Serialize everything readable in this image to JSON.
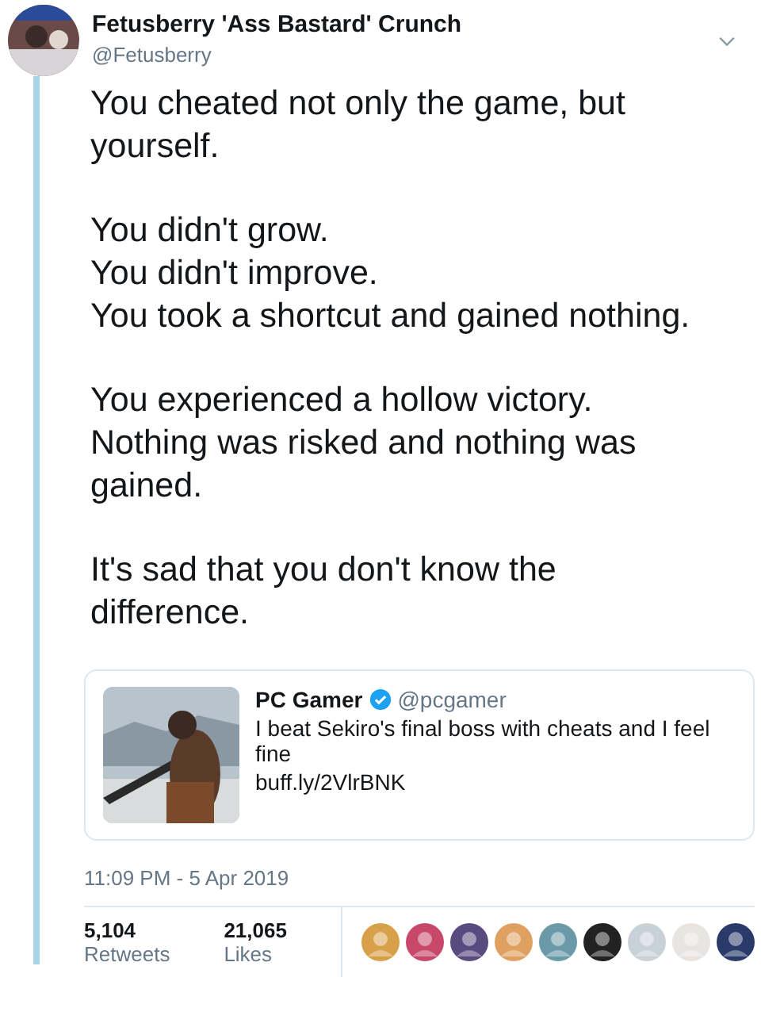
{
  "author": {
    "name": "Fetusberry 'Ass Bastard' Crunch",
    "handle": "@Fetusberry"
  },
  "paragraphs": [
    [
      "You cheated not only the game, but",
      "yourself."
    ],
    [
      "You didn't grow.",
      "You didn't improve.",
      "You took a shortcut and gained nothing."
    ],
    [
      "You experienced a hollow victory.",
      "Nothing was risked and nothing was",
      "gained."
    ],
    [
      "It's sad that you don't know the",
      "difference."
    ]
  ],
  "quote": {
    "name": "PC Gamer",
    "verified": true,
    "handle": "@pcgamer",
    "text": "I beat Sekiro's final boss with cheats and I feel fine",
    "link": "buff.ly/2VlrBNK",
    "media": {
      "kind": "picture"
    }
  },
  "timestamp": "11:09 PM - 5 Apr 2019",
  "stats": [
    {
      "count": "5,104",
      "label": "Retweets"
    },
    {
      "count": "21,065",
      "label": "Likes"
    }
  ],
  "liker_avatars": [
    {
      "kind": "picture"
    },
    {
      "kind": "picture"
    },
    {
      "kind": "picture"
    },
    {
      "kind": "picture"
    },
    {
      "kind": "picture"
    },
    {
      "kind": "picture"
    },
    {
      "kind": "picture"
    },
    {
      "kind": "picture"
    },
    {
      "kind": "picture"
    }
  ]
}
